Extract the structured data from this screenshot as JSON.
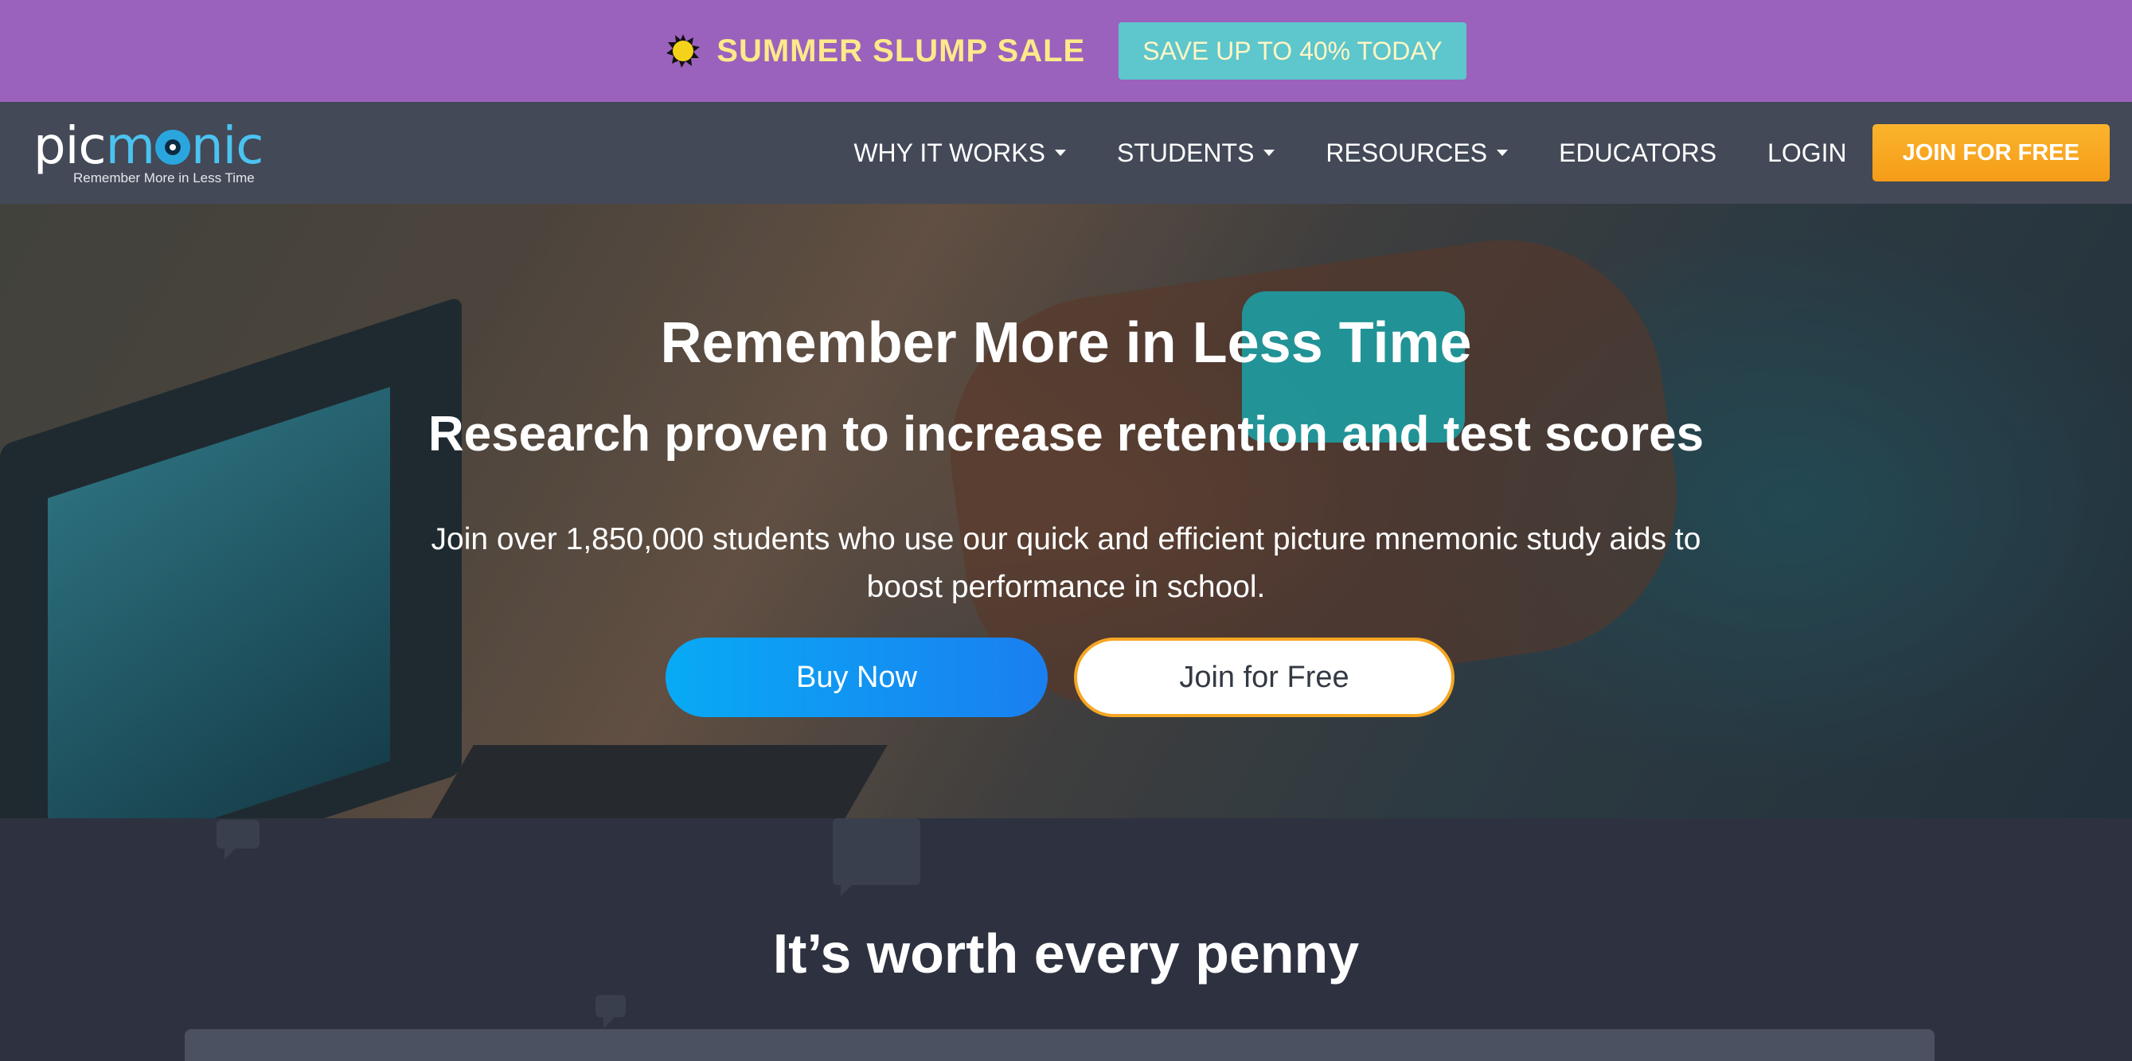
{
  "promo": {
    "icon": "sun-burst-icon",
    "sale_text": "SUMMER SLUMP SALE",
    "save_button": "SAVE UP TO 40% TODAY"
  },
  "nav": {
    "logo_word": "picmonic",
    "logo_tagline": "Remember More in Less Time",
    "items": [
      {
        "label": "WHY IT WORKS",
        "dropdown": true
      },
      {
        "label": "STUDENTS",
        "dropdown": true
      },
      {
        "label": "RESOURCES",
        "dropdown": true
      },
      {
        "label": "EDUCATORS",
        "dropdown": false
      },
      {
        "label": "LOGIN",
        "dropdown": false
      }
    ],
    "join_button": "JOIN FOR FREE"
  },
  "hero": {
    "title": "Remember More in Less Time",
    "subtitle": "Research proven to increase retention and test scores",
    "body": "Join over 1,850,000 students who use our quick and efficient picture mnemonic study aids to boost performance in school.",
    "buy_button": "Buy Now",
    "join_button": "Join for Free"
  },
  "lower": {
    "heading": "It’s worth every penny"
  },
  "colors": {
    "promo_bg": "#9a62bd",
    "sale_text": "#fde98a",
    "save_button_bg": "#5ec6cd",
    "nav_bg": "#434957",
    "join_nav_bg": "#f8a91f",
    "buy_button_bg": "#08aaf5",
    "join_free_border": "#f5a623",
    "page_bg": "#2e3240"
  }
}
